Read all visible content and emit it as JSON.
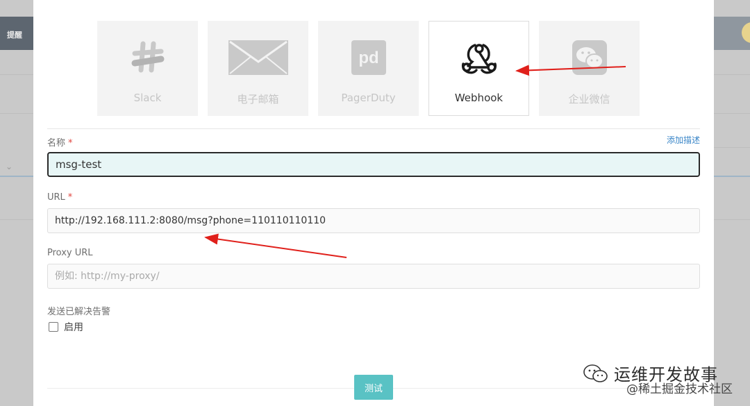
{
  "background": {
    "topbar_text": "提醒"
  },
  "channels": [
    {
      "key": "slack",
      "label": "Slack",
      "icon": "slack-icon",
      "selected": false
    },
    {
      "key": "email",
      "label": "电子邮箱",
      "icon": "envelope-icon",
      "selected": false
    },
    {
      "key": "pagerduty",
      "label": "PagerDuty",
      "icon": "pagerduty-icon",
      "selected": false
    },
    {
      "key": "webhook",
      "label": "Webhook",
      "icon": "webhook-icon",
      "selected": true
    },
    {
      "key": "wechat_work",
      "label": "企业微信",
      "icon": "wechat-icon",
      "selected": false
    }
  ],
  "form": {
    "name_label": "名称",
    "required_mark": "*",
    "add_description": "添加描述",
    "name_value": "msg-test",
    "url_label": "URL",
    "url_value": "http://192.168.111.2:8080/msg?phone=110110110110",
    "proxy_label": "Proxy URL",
    "proxy_placeholder": "例如: http://my-proxy/",
    "send_resolved_label": "发送已解决告警",
    "enable_label": "启用",
    "enable_checked": false,
    "test_button": "测试"
  },
  "watermark": {
    "title": "运维开发故事",
    "subtitle": "@稀土掘金技术社区"
  },
  "colors": {
    "accent": "#59c2c4",
    "link": "#3a86c8",
    "required": "#e0443e",
    "annotation": "#e0201b"
  }
}
